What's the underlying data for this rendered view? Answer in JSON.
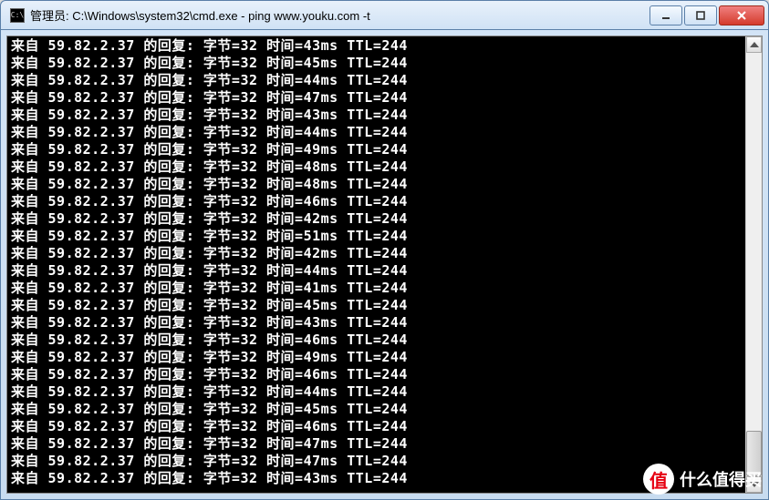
{
  "window": {
    "title": "管理员: C:\\Windows\\system32\\cmd.exe - ping  www.youku.com -t",
    "icon_label": "C:\\"
  },
  "ping": {
    "ip": "59.82.2.37",
    "prefix": "来自",
    "reply_label": "的回复:",
    "bytes_label": "字节",
    "bytes": 32,
    "time_label": "时间",
    "ttl_label": "TTL",
    "ttl": 244,
    "times_ms": [
      43,
      45,
      44,
      47,
      43,
      44,
      49,
      48,
      48,
      46,
      42,
      51,
      42,
      44,
      41,
      45,
      43,
      46,
      49,
      46,
      44,
      45,
      46,
      47,
      47,
      43
    ]
  },
  "watermark": {
    "circle_text": "值",
    "text": "什么值得买"
  }
}
